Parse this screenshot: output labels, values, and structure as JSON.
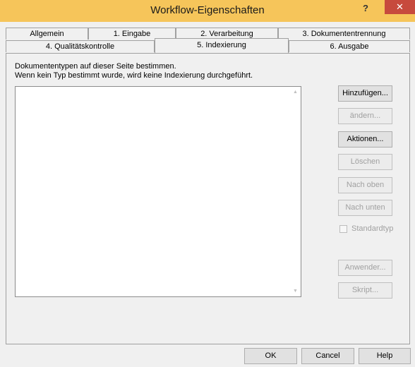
{
  "window": {
    "title": "Workflow-Eigenschaften",
    "help_label": "?",
    "close_label": "✕"
  },
  "tabs": {
    "row1": [
      {
        "label": "Allgemein"
      },
      {
        "label": "1. Eingabe"
      },
      {
        "label": "2. Verarbeitung"
      },
      {
        "label": "3. Dokumententrennung"
      }
    ],
    "row2": [
      {
        "label": "4. Qualitätskontrolle"
      },
      {
        "label": "5. Indexierung"
      },
      {
        "label": "6. Ausgabe"
      }
    ],
    "active": "5. Indexierung"
  },
  "panel": {
    "description_line1": "Dokumententypen auf dieser Seite bestimmen.",
    "description_line2": "Wenn kein Typ bestimmt wurde, wird keine Indexierung durchgeführt.",
    "buttons": {
      "add": "Hinzufügen...",
      "edit": "ändern...",
      "actions": "Aktionen...",
      "delete": "Löschen",
      "move_down": "Nach oben",
      "move_up": "Nach unten",
      "default_type": "Standardtyp",
      "apply": "Anwender...",
      "script": "Skript..."
    }
  },
  "footer": {
    "ok": "OK",
    "cancel": "Cancel",
    "help": "Help"
  },
  "icons": {
    "scroll_up": "▲",
    "scroll_down": "▼"
  }
}
